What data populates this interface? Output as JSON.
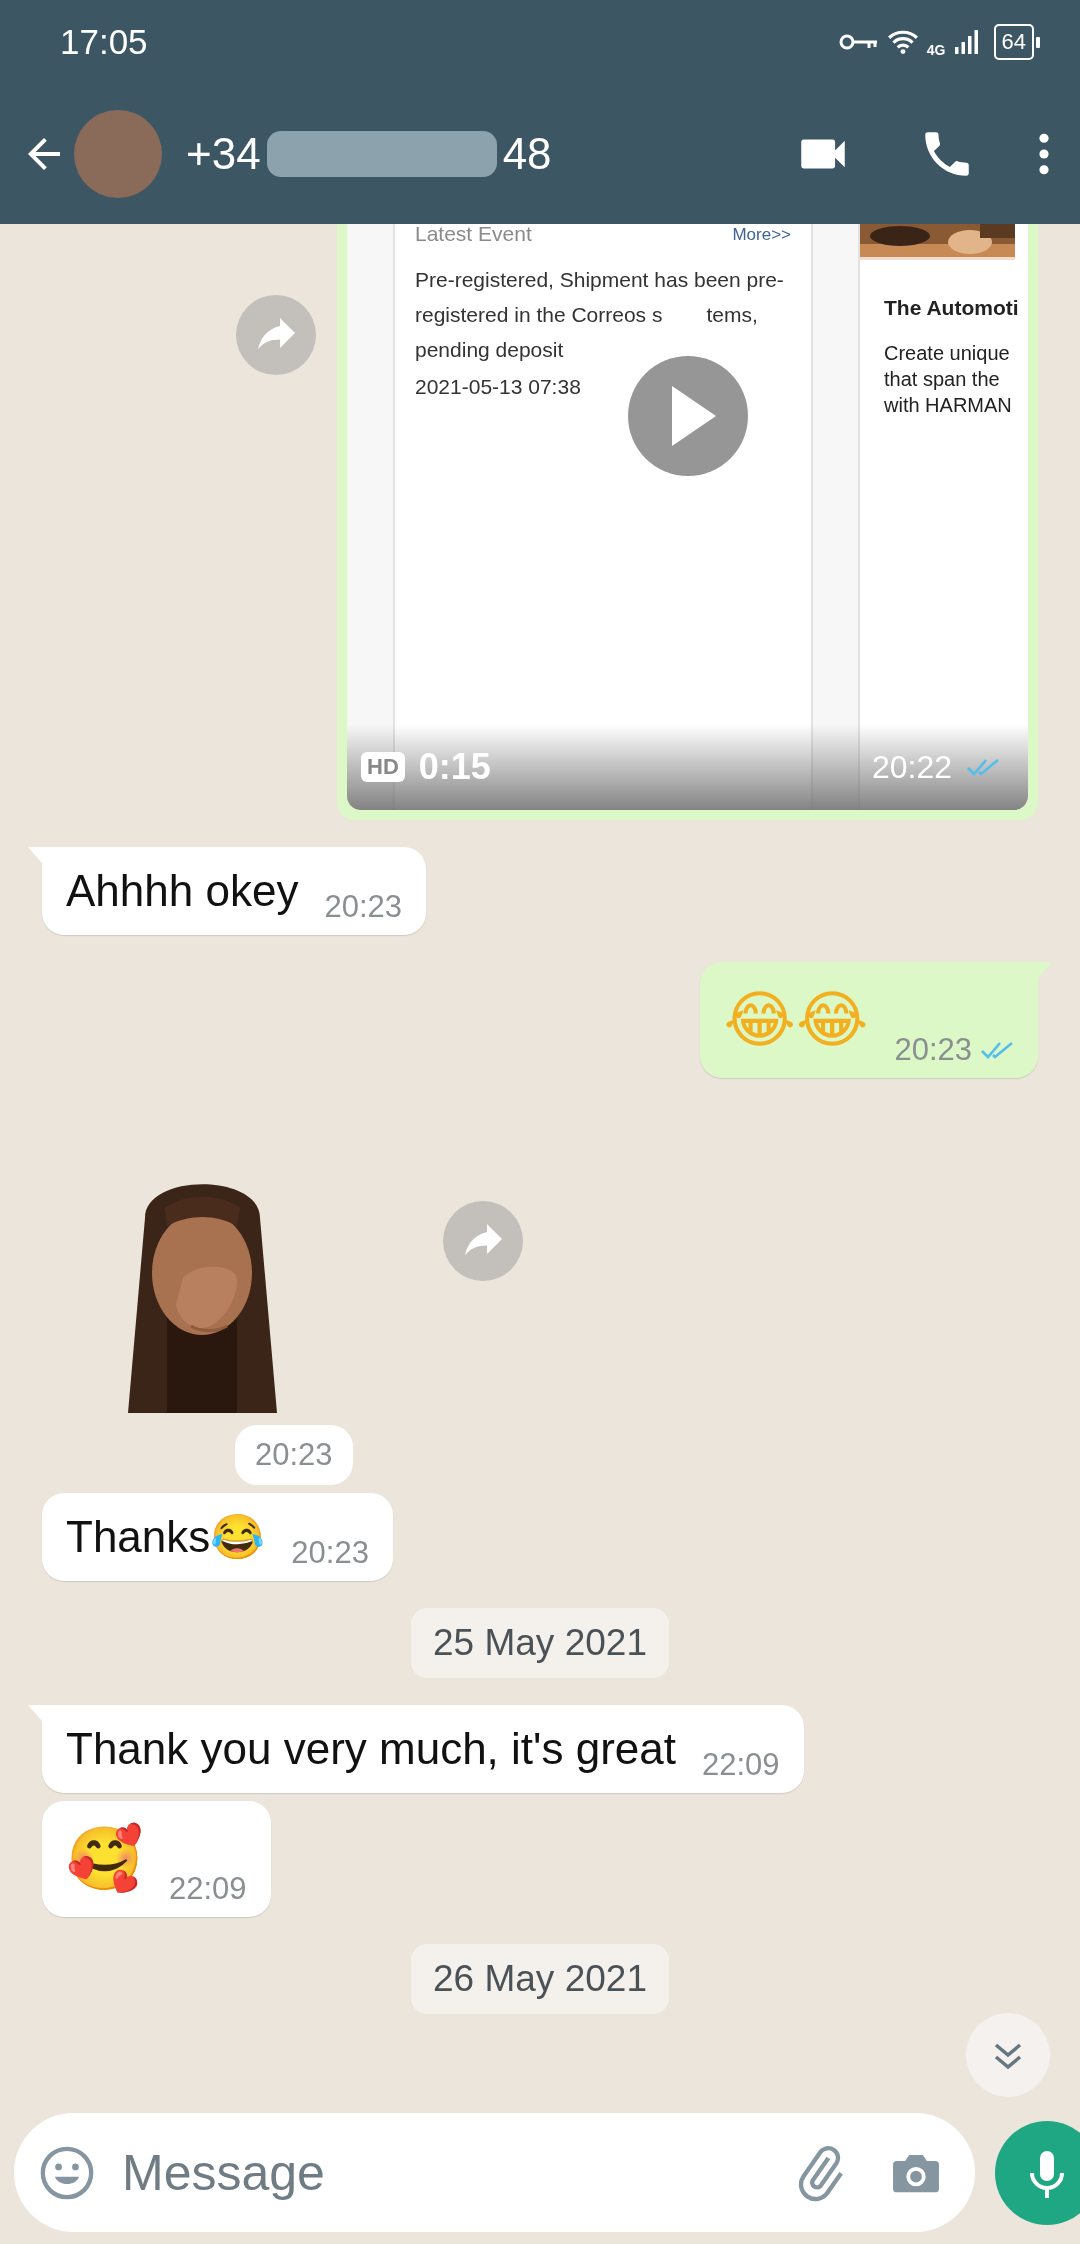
{
  "status_bar": {
    "time": "17:05",
    "network": "4G",
    "battery": "64"
  },
  "header": {
    "number_start": "+34",
    "number_end": "48"
  },
  "messages": [
    {
      "kind": "video",
      "outgoing": true,
      "forward": true,
      "thumbnail": {
        "heading": "Latest Event",
        "link": "More>>",
        "lines": [
          [
            "Pre-registered, Shipment has been pre-"
          ],
          [
            "registered in the Correos s",
            "tems,"
          ],
          [
            "pending deposit"
          ]
        ],
        "date": "2021-05-13 07:38",
        "side_title": "The Automoti",
        "side_lines": [
          "Create unique",
          "that span the",
          "with HARMAN"
        ]
      },
      "badge": "HD",
      "duration": "0:15",
      "time": "20:22",
      "read": true
    },
    {
      "kind": "text",
      "outgoing": false,
      "text": "Ahhhh okey",
      "time": "20:23"
    },
    {
      "kind": "emoji",
      "outgoing": true,
      "text": "😂😂",
      "time": "20:23",
      "read": true
    },
    {
      "kind": "sticker",
      "outgoing": false,
      "forward": true,
      "time": "20:23"
    },
    {
      "kind": "text",
      "outgoing": false,
      "text": "Thanks😂",
      "time": "20:23"
    },
    {
      "kind": "date",
      "text": "25 May 2021"
    },
    {
      "kind": "text",
      "outgoing": false,
      "text": "Thank you very much, it's great",
      "time": "22:09"
    },
    {
      "kind": "emoji",
      "outgoing": false,
      "text": "🥰",
      "time": "22:09"
    },
    {
      "kind": "date",
      "text": "26 May 2021"
    }
  ],
  "composer": {
    "placeholder": "Message"
  }
}
